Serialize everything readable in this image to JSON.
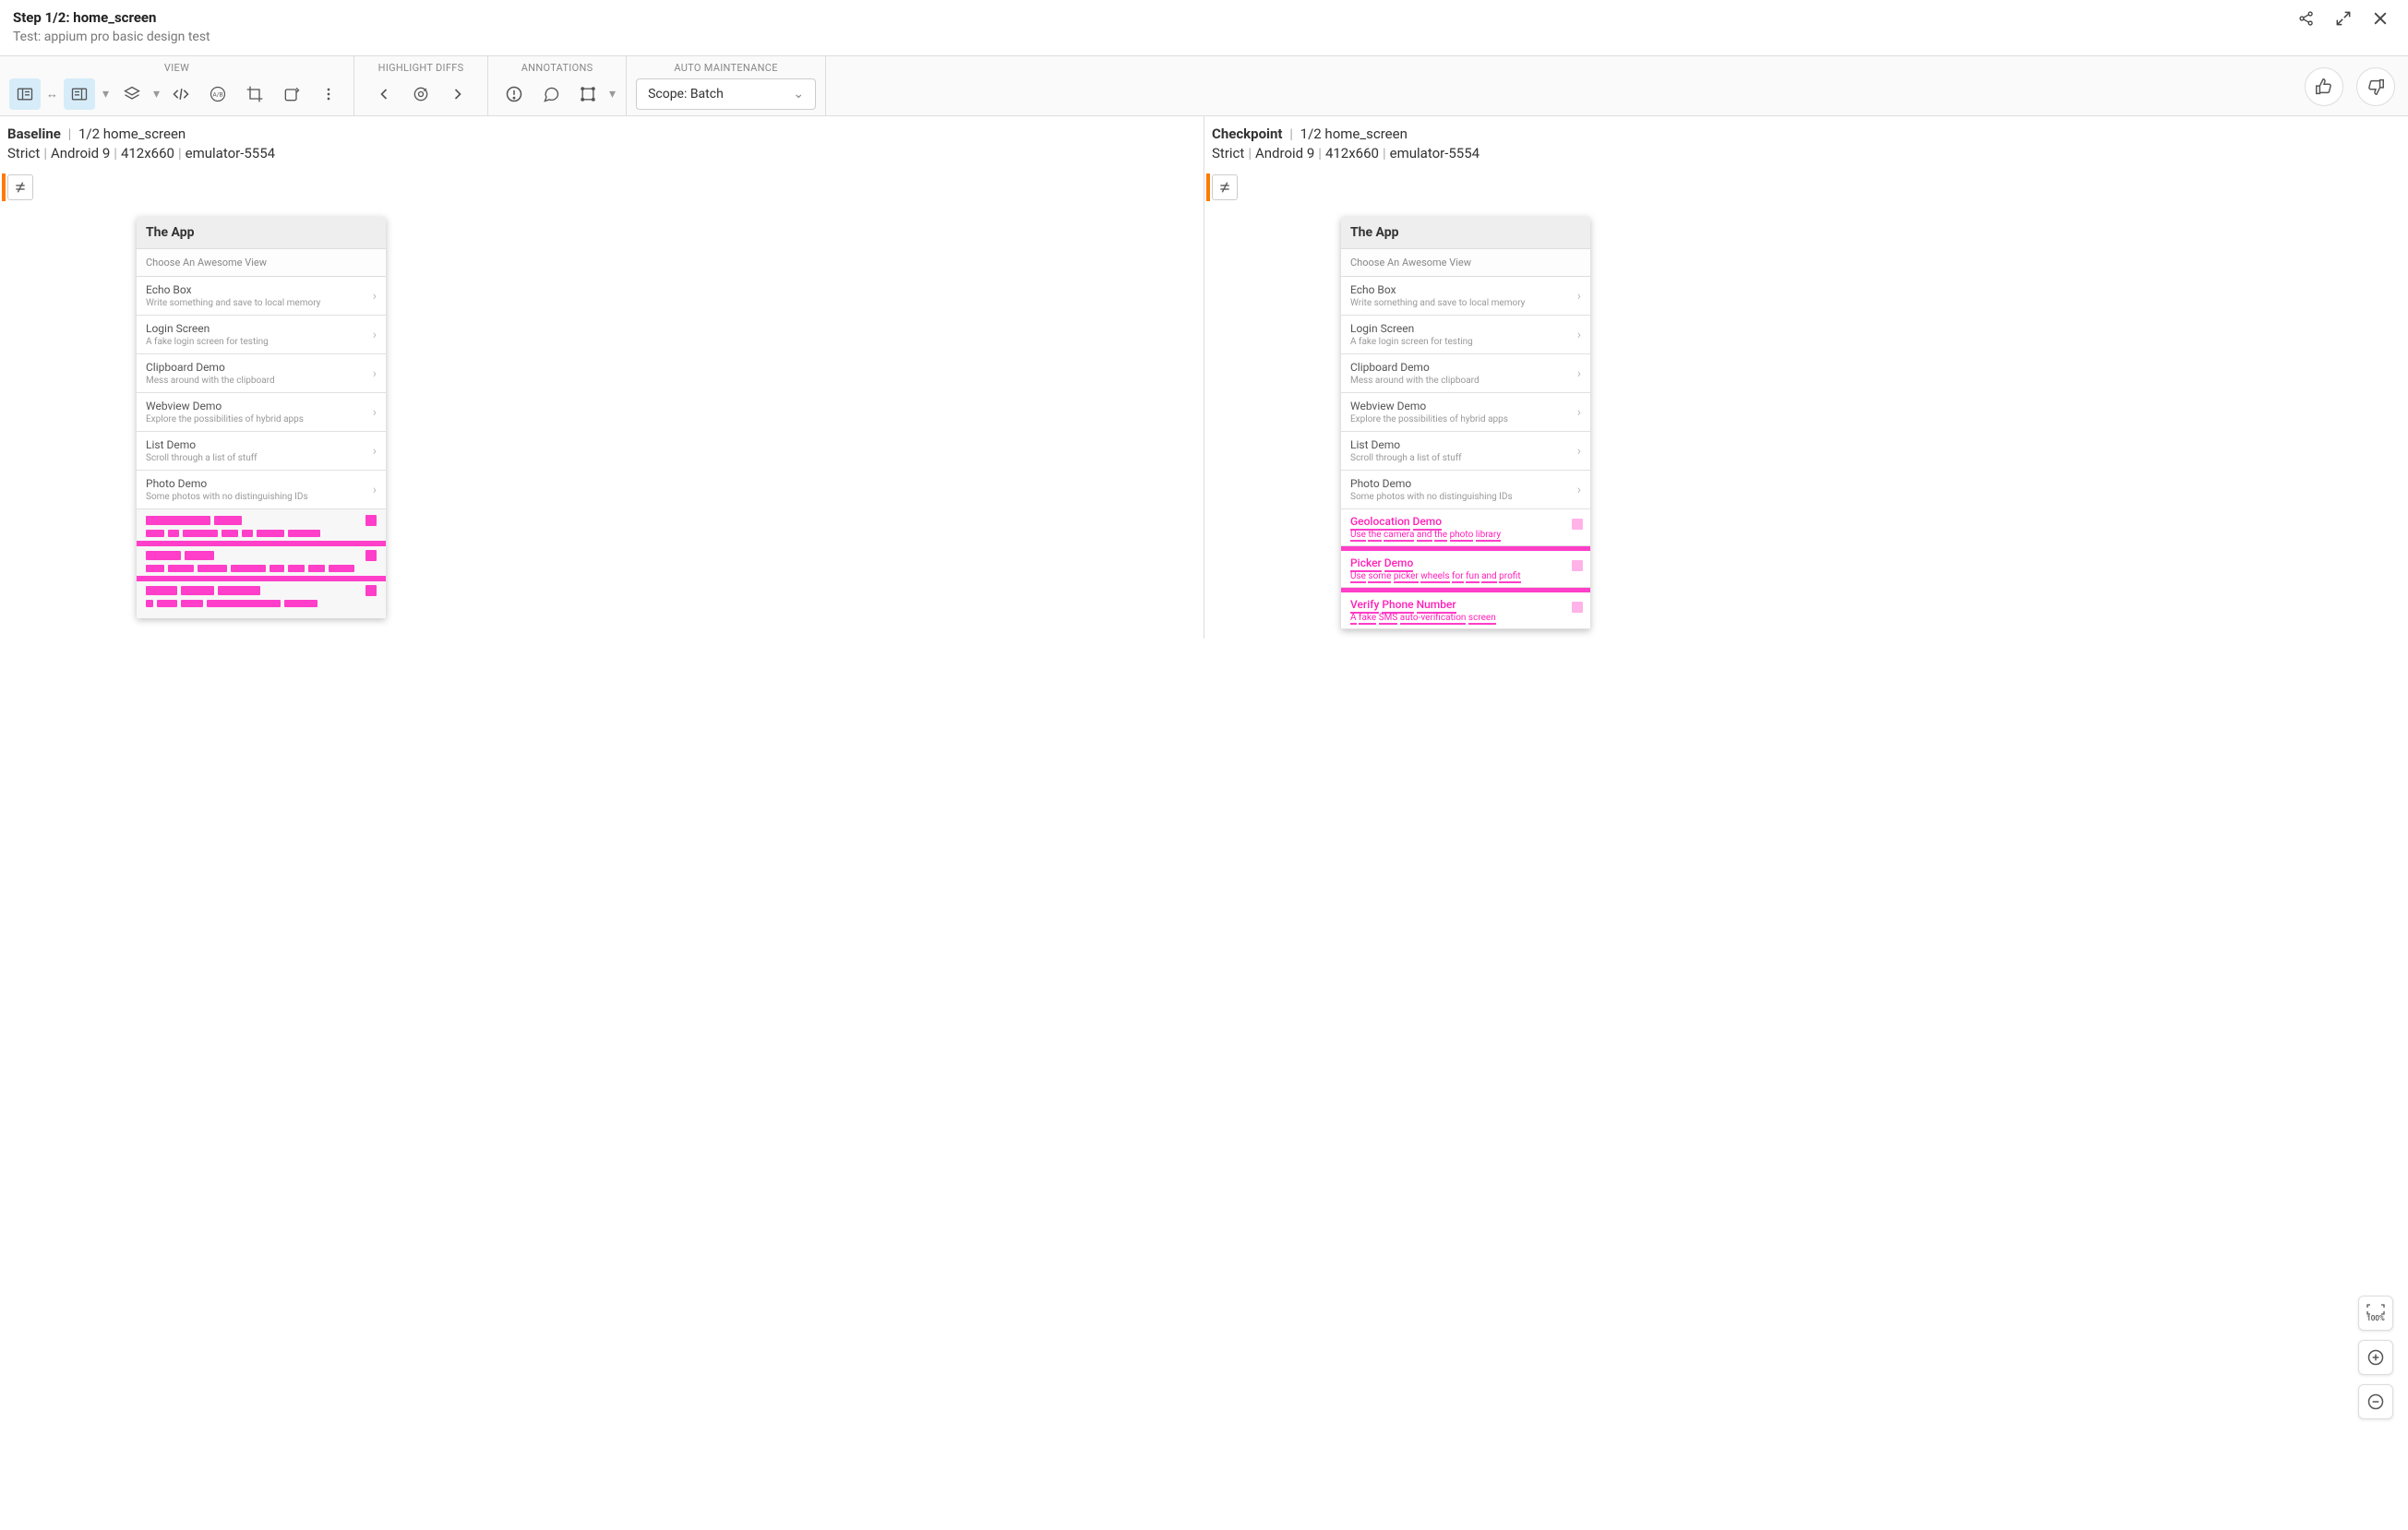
{
  "header": {
    "step": "Step 1/2:  home_screen",
    "test": "Test: appium pro basic design test"
  },
  "toolbar": {
    "labels": {
      "view": "VIEW",
      "diffs": "HIGHLIGHT DIFFS",
      "annotations": "ANNOTATIONS",
      "maintenance": "AUTO MAINTENANCE"
    },
    "scope": "Scope: Batch"
  },
  "panes": {
    "baseline": {
      "title": "Baseline",
      "step": "1/2 home_screen",
      "match": "Strict",
      "os": "Android 9",
      "viewport": "412x660",
      "device": "emulator-5554"
    },
    "checkpoint": {
      "title": "Checkpoint",
      "step": "1/2 home_screen",
      "match": "Strict",
      "os": "Android 9",
      "viewport": "412x660",
      "device": "emulator-5554"
    }
  },
  "mock": {
    "app_title": "The App",
    "choose": "Choose An Awesome View",
    "items": [
      {
        "title": "Echo Box",
        "sub": "Write something and save to local memory"
      },
      {
        "title": "Login Screen",
        "sub": "A fake login screen for testing"
      },
      {
        "title": "Clipboard Demo",
        "sub": "Mess around with the clipboard"
      },
      {
        "title": "Webview Demo",
        "sub": "Explore the possibilities of hybrid apps"
      },
      {
        "title": "List Demo",
        "sub": "Scroll through a list of stuff"
      },
      {
        "title": "Photo Demo",
        "sub": "Some photos with no distinguishing IDs"
      }
    ],
    "diff_items": [
      {
        "title": "Geolocation Demo",
        "sub": "Use the camera and the photo library"
      },
      {
        "title": "Picker Demo",
        "sub": "Use some picker wheels for fun and profit"
      },
      {
        "title": "Verify Phone Number",
        "sub": "A fake SMS auto-verification screen"
      }
    ]
  },
  "zoom": {
    "label": "100%"
  }
}
